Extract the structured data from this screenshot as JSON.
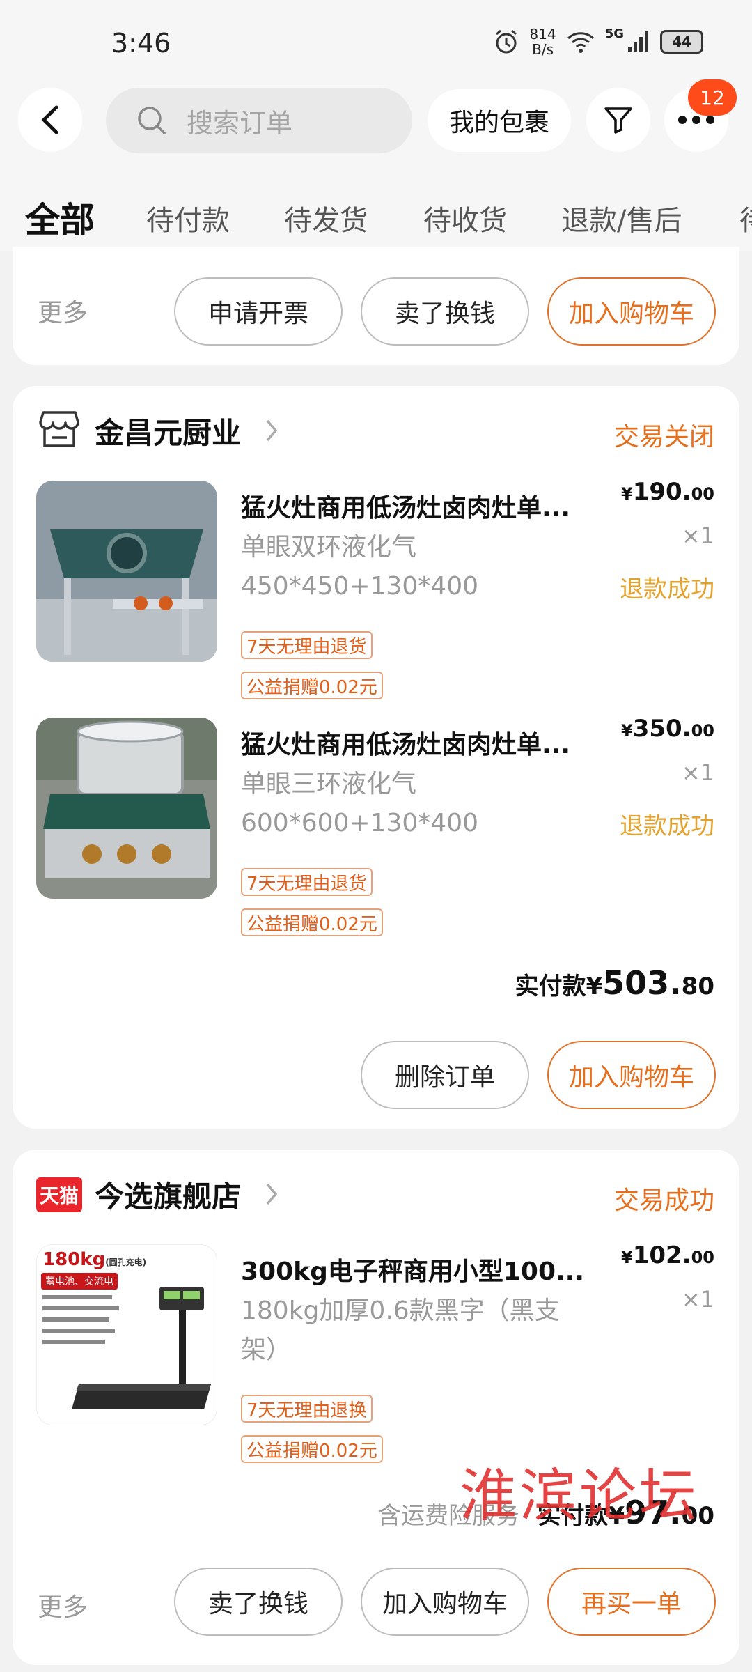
{
  "status_bar": {
    "time": "3:46",
    "net_speed_top": "814",
    "net_speed_bottom": "B/s",
    "network": "5G",
    "battery": "44"
  },
  "header": {
    "search_placeholder": "搜索订单",
    "package_label": "我的包裹",
    "more_badge": "12"
  },
  "tabs": [
    "全部",
    "待付款",
    "待发货",
    "待收货",
    "退款/售后",
    "待"
  ],
  "partial_card": {
    "more_label": "更多",
    "buttons": [
      "申请开票",
      "卖了换钱",
      "加入购物车"
    ]
  },
  "orders": [
    {
      "shop": "金昌元厨业",
      "status": "交易关闭",
      "items": [
        {
          "title": "猛火灶商用低汤灶卤肉灶单...",
          "spec1": "单眼双环液化气",
          "spec2": "450*450+130*400",
          "price_currency": "¥",
          "price_int": "190.",
          "price_dec": "00",
          "qty": "×1",
          "refund": "退款成功",
          "tags": [
            "7天无理由退货",
            "公益捐赠0.02元"
          ]
        },
        {
          "title": "猛火灶商用低汤灶卤肉灶单...",
          "spec1": "单眼三环液化气",
          "spec2": "600*600+130*400",
          "price_currency": "¥",
          "price_int": "350.",
          "price_dec": "00",
          "qty": "×1",
          "refund": "退款成功",
          "tags": [
            "7天无理由退货",
            "公益捐赠0.02元"
          ]
        }
      ],
      "paid_label": "实付款¥",
      "paid_int": "503.",
      "paid_dec": "80",
      "buttons": [
        "删除订单",
        "加入购物车"
      ]
    },
    {
      "shop_badge": "天猫",
      "shop": "今选旗舰店",
      "status": "交易成功",
      "items": [
        {
          "title": "300kg电子秤商用小型100...",
          "spec1": "180kg加厚0.6款黑字（黑支",
          "spec2": "架）",
          "price_currency": "¥",
          "price_int": "102.",
          "price_dec": "00",
          "qty": "×1",
          "tags": [
            "7天无理由退换",
            "公益捐赠0.02元"
          ],
          "image_caption": "180kg",
          "image_caption_sub": "(圆孔充电)",
          "image_banner": "蓄电池、交流电"
        }
      ],
      "service_note": "含运费险服务",
      "paid_label": "实付款¥",
      "paid_int": "97.",
      "paid_dec": "00",
      "more_label": "更多",
      "buttons": [
        "卖了换钱",
        "加入购物车",
        "再买一单"
      ]
    }
  ],
  "watermark": "淮滨论坛",
  "colors": {
    "accent": "#e66f1e",
    "refund": "#e3a22e",
    "badge": "#ff4a1a",
    "tmall": "#e8262c"
  }
}
